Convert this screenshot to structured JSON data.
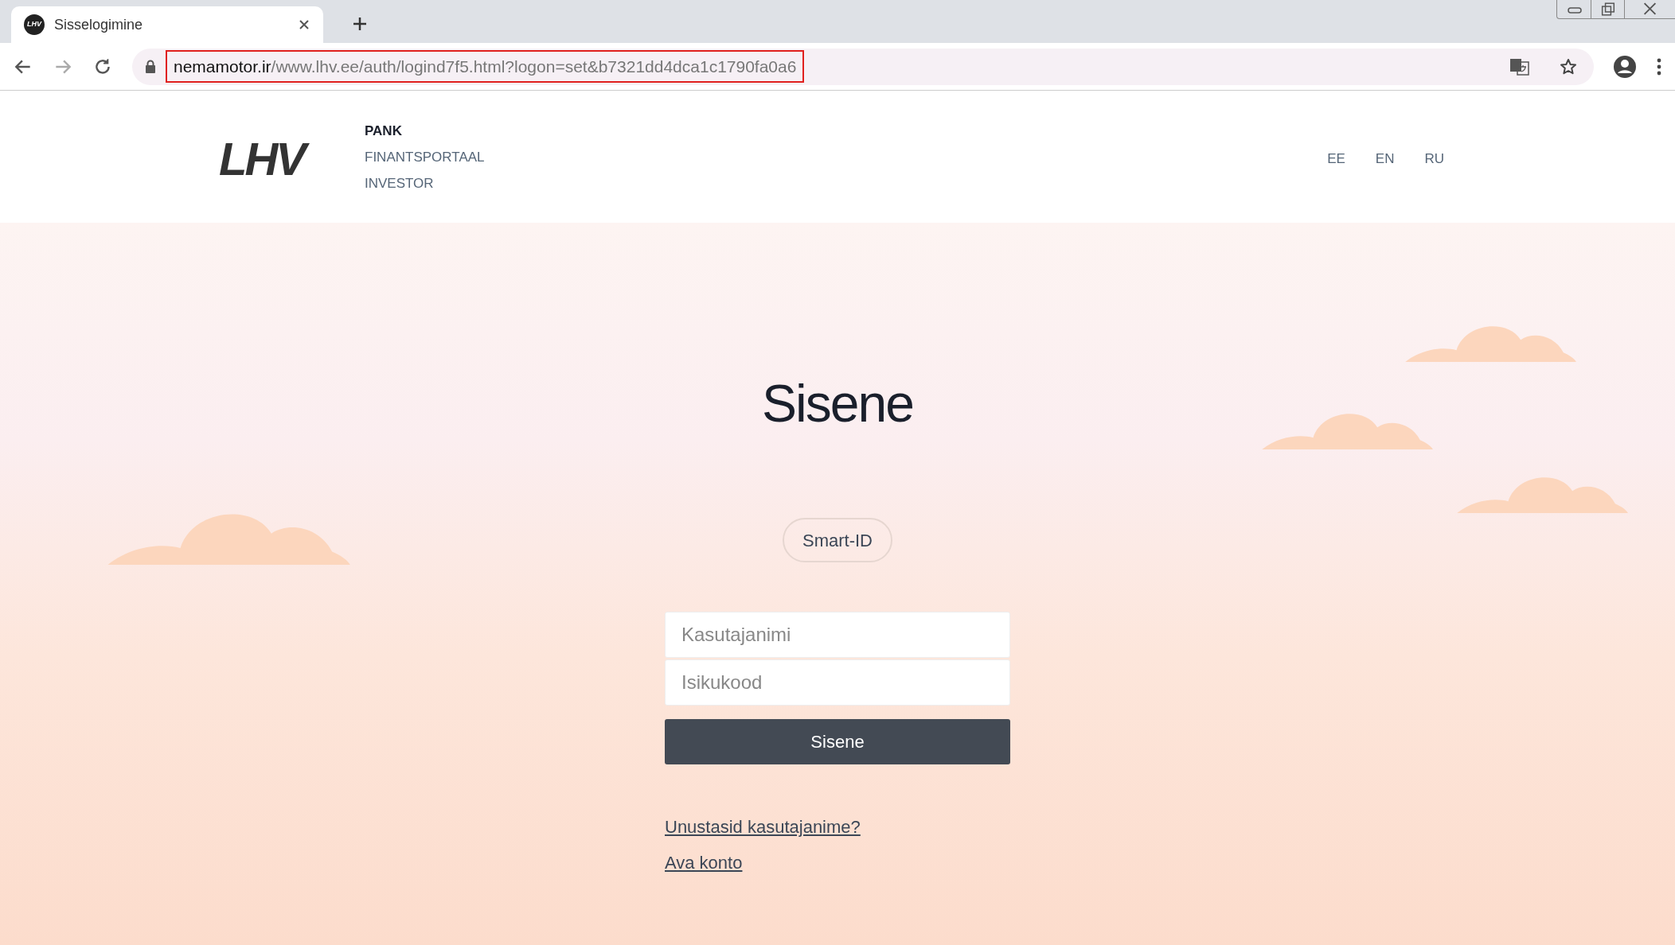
{
  "browser": {
    "tab": {
      "title": "Sisselogimine",
      "favicon": "LHV"
    },
    "address_bar": {
      "host": "nemamotor.ir",
      "path": "/www.lhv.ee/auth/logind7f5.html?logon=set&b7321dd4dca1c1790fa0a6",
      "highlighted": true
    }
  },
  "header": {
    "logo": "LHV",
    "nav": [
      {
        "label": "PANK",
        "selected": true
      },
      {
        "label": "FINANTSPORTAAL",
        "selected": false
      },
      {
        "label": "INVESTOR",
        "selected": false
      }
    ],
    "languages": [
      "EE",
      "EN",
      "RU"
    ]
  },
  "login": {
    "title": "Sisene",
    "smart_id_button": "Smart-ID",
    "fields": [
      {
        "placeholder": "Kasutajanimi"
      },
      {
        "placeholder": "Isikukood"
      }
    ],
    "submit": "Sisene",
    "links": [
      "Unustasid kasutajanime?",
      "Ava konto"
    ]
  }
}
